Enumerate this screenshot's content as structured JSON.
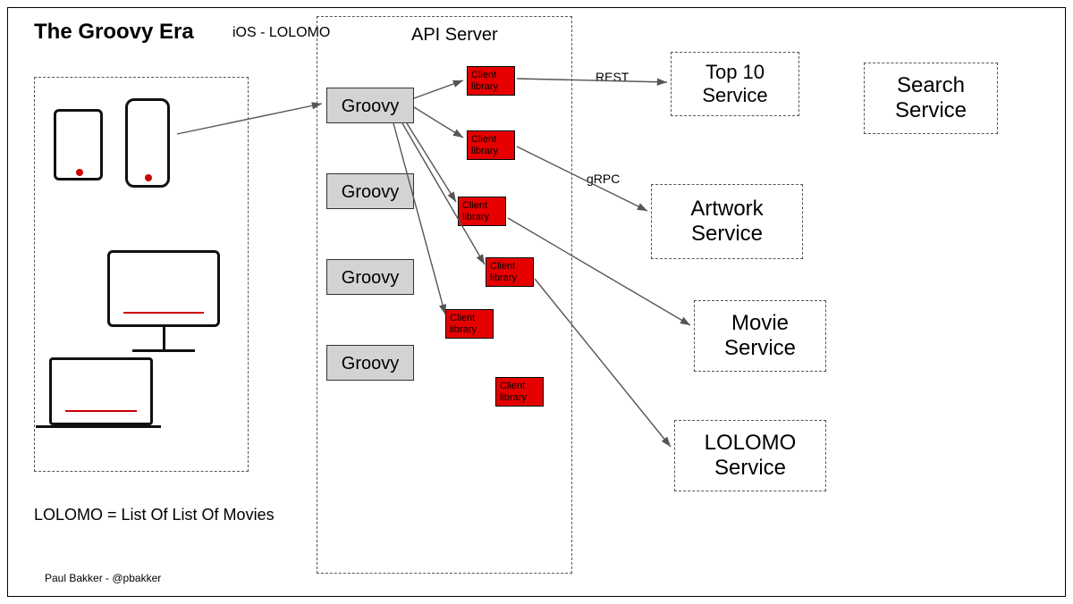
{
  "title": "The Groovy Era",
  "subtitle": "iOS - LOLOMO",
  "api_server_label": "API Server",
  "groovy": [
    "Groovy",
    "Groovy",
    "Groovy",
    "Groovy"
  ],
  "client_library_label": "Client\nlibrary",
  "protocols": {
    "rest": "REST",
    "grpc": "gRPC"
  },
  "services": {
    "top10": "Top 10\nService",
    "artwork": "Artwork\nService",
    "movie": "Movie\nService",
    "lolomo": "LOLOMO\nService",
    "search": "Search\nService"
  },
  "footnote": "LOLOMO = List Of List Of Movies",
  "credit": "Paul Bakker - @pbakker"
}
